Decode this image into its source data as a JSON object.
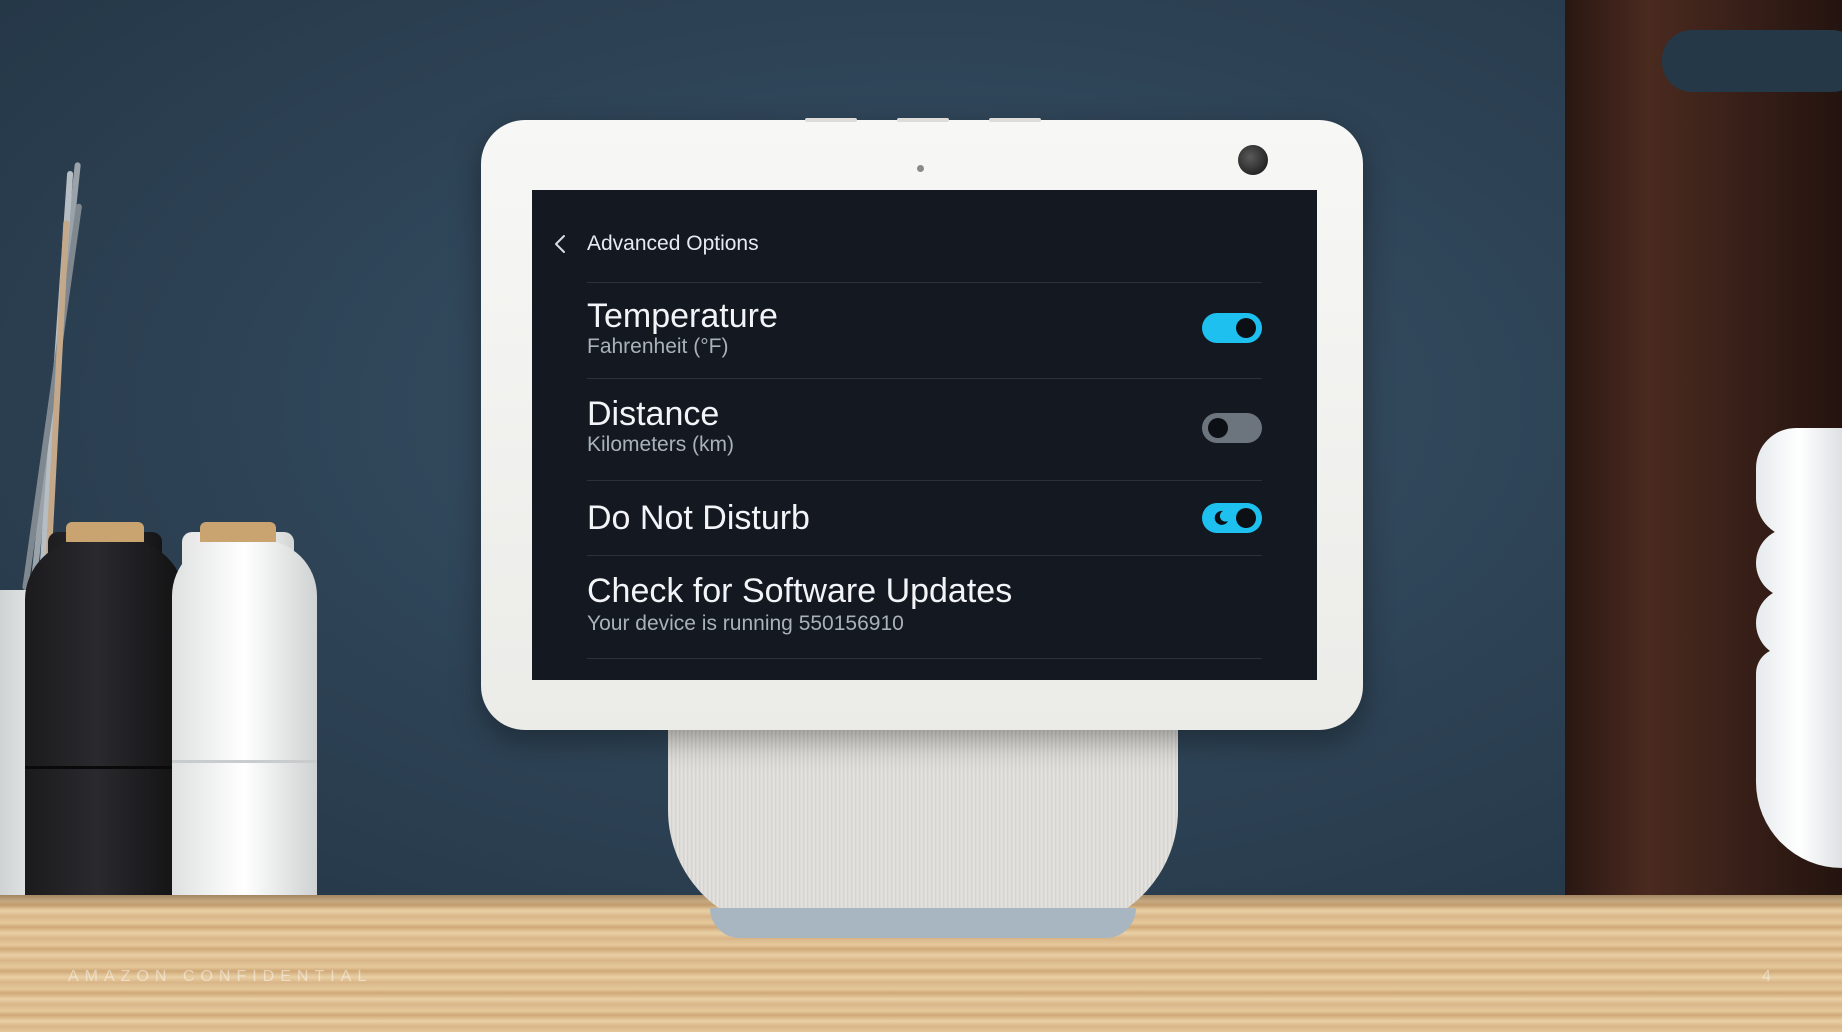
{
  "header": {
    "title": "Advanced Options",
    "back_icon": "chevron-left-icon"
  },
  "settings": [
    {
      "title": "Temperature",
      "subtitle": "Fahrenheit (°F)",
      "toggle": "on"
    },
    {
      "title": "Distance",
      "subtitle": "Kilometers (km)",
      "toggle": "off"
    },
    {
      "title": "Do Not Disturb",
      "toggle": "on",
      "toggle_icon": "moon-icon"
    },
    {
      "title": "Check for Software Updates",
      "subtitle": "Your device is running 550156910"
    }
  ],
  "watermark": {
    "left": "AMAZON CONFIDENTIAL",
    "right": "4"
  },
  "colors": {
    "accent": "#1ec0f0",
    "screen_background": "#131821",
    "toggle_off": "#6c757d",
    "wall": "#2f4558"
  }
}
